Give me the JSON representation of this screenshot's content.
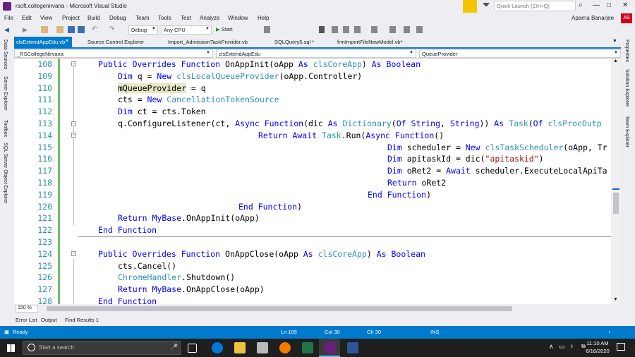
{
  "window": {
    "title": "rsoft.collegenirvana - Microsoft Visual Studio",
    "quick_launch_placeholder": "Quick Launch (Ctrl+Q)",
    "user": "Aparna Banarjee",
    "avatar": "AB"
  },
  "menu": [
    "File",
    "Edit",
    "View",
    "Project",
    "Build",
    "Debug",
    "Team",
    "Tools",
    "Test",
    "Analyze",
    "Window",
    "Help"
  ],
  "toolbar": {
    "config": "Debug",
    "platform": "Any CPU",
    "start": "Start"
  },
  "left_panels": [
    "Data Sources",
    "Server Explorer",
    "Toolbox",
    "SQL Server Object Explorer"
  ],
  "right_panels": [
    "Properties",
    "Solution Explorer",
    "Team Explorer"
  ],
  "tabs": [
    "clsExtendAppEdu.vb",
    "Source Control Explorer",
    "Import_AdmissionTaskProvider.vb",
    "SQLQuery5.sql *",
    "frmImportFileNewModel.vb*"
  ],
  "nav": {
    "project": "_RSCollegeNirvana",
    "class": "clsExtendAppEdu",
    "member": "QueueProvider"
  },
  "lines": [
    "108",
    "109",
    "110",
    "111",
    "112",
    "113",
    "114",
    "115",
    "116",
    "117",
    "118",
    "119",
    "120",
    "121",
    "122",
    "123",
    "124",
    "125",
    "126",
    "127",
    "128"
  ],
  "code": {
    "l108": {
      "kw1": "Public Overrides Function",
      "t1": " OnAppInit(oApp ",
      "kw2": "As",
      "t2": " ",
      "ty1": "clsCoreApp",
      "t3": ") ",
      "kw3": "As Boolean"
    },
    "l109": {
      "kw1": "Dim",
      "t1": " q = ",
      "kw2": "New",
      "t2": " ",
      "ty1": "clsLocalQueueProvider",
      "t3": "(oApp.Controller)"
    },
    "l110": {
      "t1": "mQueueProvider",
      "t2": " = q"
    },
    "l111": {
      "t1": "cts = ",
      "kw1": "New",
      "t2": " ",
      "ty1": "CancellationTokenSource"
    },
    "l112": {
      "kw1": "Dim",
      "t1": " ct = cts.Token"
    },
    "l113": {
      "t1": "q.ConfigureListener(ct, ",
      "kw1": "Async Function",
      "t2": "(dic ",
      "kw2": "As",
      "t3": " ",
      "ty1": "Dictionary",
      "t4": "(",
      "kw3": "Of String",
      "t5": ", ",
      "kw4": "String",
      "t6": ")) ",
      "kw5": "As",
      "t7": " ",
      "ty2": "Task",
      "t8": "(",
      "kw6": "Of",
      "t9": " ",
      "ty3": "clsProcOutp"
    },
    "l114": {
      "kw1": "Return Await",
      "t1": " ",
      "ty1": "Task",
      "t2": ".Run(",
      "kw2": "Async Function",
      "t3": "()"
    },
    "l115": {
      "kw1": "Dim",
      "t1": " scheduler = ",
      "kw2": "New",
      "t2": " ",
      "ty1": "clsTaskScheduler",
      "t3": "(oApp, Tr"
    },
    "l116": {
      "kw1": "Dim",
      "t1": " apitaskId = dic(",
      "st1": "\"apitaskid\"",
      "t2": ")"
    },
    "l117": {
      "kw1": "Dim",
      "t1": " oRet2 = ",
      "kw2": "Await",
      "t2": " scheduler.ExecuteLocalApiTa"
    },
    "l118": {
      "kw1": "Return",
      "t1": " oRet2"
    },
    "l119": {
      "kw1": "End Function",
      "t1": ")"
    },
    "l120": {
      "kw1": "End Function",
      "t1": ")"
    },
    "l121": {
      "kw1": "Return",
      "t1": " ",
      "kw2": "MyBase",
      "t2": ".OnAppInit(oApp)"
    },
    "l122": {
      "kw1": "End Function"
    },
    "l124": {
      "kw1": "Public Overrides Function",
      "t1": " OnAppClose(oApp ",
      "kw2": "As",
      "t2": " ",
      "ty1": "clsCoreApp",
      "t3": ") ",
      "kw3": "As Boolean"
    },
    "l125": {
      "t1": "cts.Cancel()"
    },
    "l126": {
      "ty1": "ChromeHandler",
      "t1": ".Shutdown()"
    },
    "l127": {
      "kw1": "Return",
      "t1": " ",
      "kw2": "MyBase",
      "t2": ".OnAppClose(oApp)"
    },
    "l128": {
      "kw1": "End Function"
    }
  },
  "zoom": "150 %",
  "bottom_tabs": [
    "Error List",
    "Output",
    "Find Results 1"
  ],
  "status": {
    "state": "Ready",
    "ln": "Ln 105",
    "col": "Col 30",
    "ch": "Ch 30",
    "mode": "INS"
  },
  "taskbar": {
    "search_placeholder": "Start a search",
    "time": "11:10 AM",
    "date": "6/16/2020"
  },
  "colors": {
    "accent": "#007acc",
    "keyword": "#0000ff",
    "type": "#2b91af",
    "string": "#a31515"
  }
}
